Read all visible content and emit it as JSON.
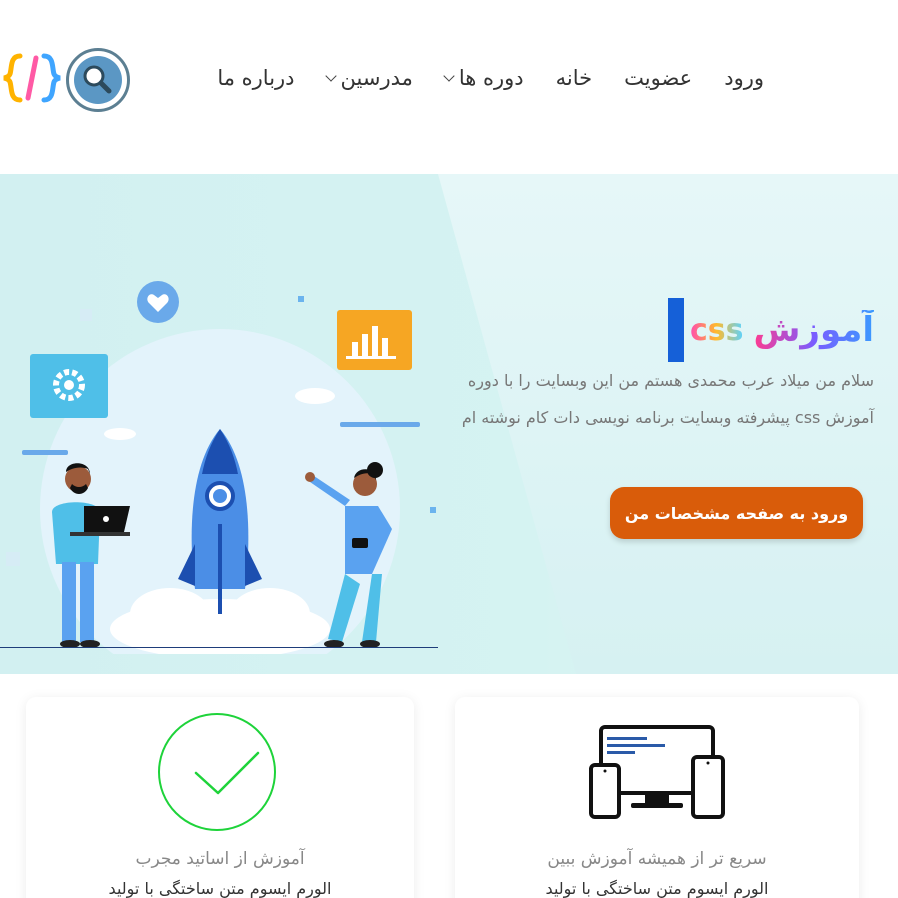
{
  "nav": {
    "items": [
      {
        "label": "ورود",
        "dropdown": false
      },
      {
        "label": "عضویت",
        "dropdown": false
      },
      {
        "label": "خانه",
        "dropdown": false
      },
      {
        "label": "دوره ها",
        "dropdown": true
      },
      {
        "label": "مدرسین",
        "dropdown": true
      },
      {
        "label": "درباره ما",
        "dropdown": false
      }
    ]
  },
  "hero": {
    "title_main": "آموزش",
    "title_accent": "css",
    "description": "سلام من میلاد عرب محمدی هستم من این وبسایت را با دوره آموزش css پیشرفته وبسایت برنامه نویسی دات کام نوشته ام",
    "cta_label": "ورود به صفحه مشخصات من"
  },
  "cards": [
    {
      "title": "آموزش از اساتید مجرب",
      "text": "الورم ایسوم متن ساختگی با تولید",
      "icon": "checkmark-circle-icon"
    },
    {
      "title": "سریع تر از همیشه آموزش ببین",
      "text": "الورم ایسوم متن ساختگی با تولید",
      "icon": "devices-icon"
    }
  ],
  "colors": {
    "accent": "#d95c0a",
    "hero_bg": "#d5f3f2",
    "cursor": "#1560d8",
    "check": "#1ed33a",
    "search": "#5b97c4"
  }
}
